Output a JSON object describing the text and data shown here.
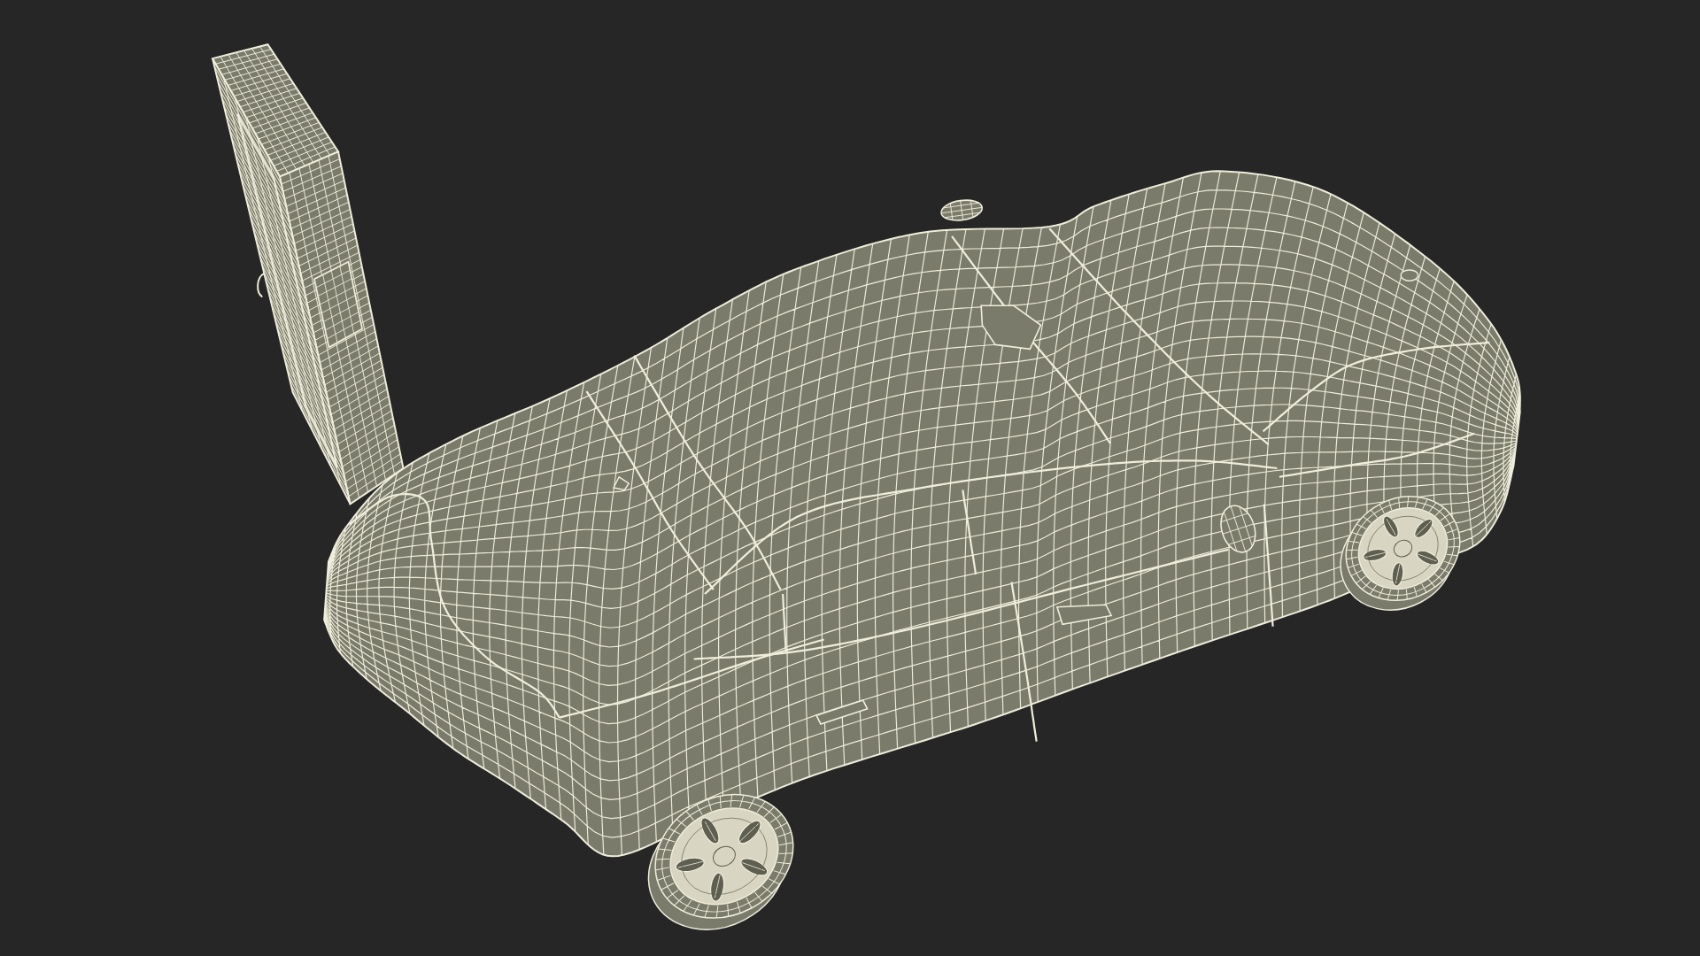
{
  "scene": {
    "objects": [
      {
        "kind": "charging-station"
      },
      {
        "kind": "car"
      }
    ]
  }
}
